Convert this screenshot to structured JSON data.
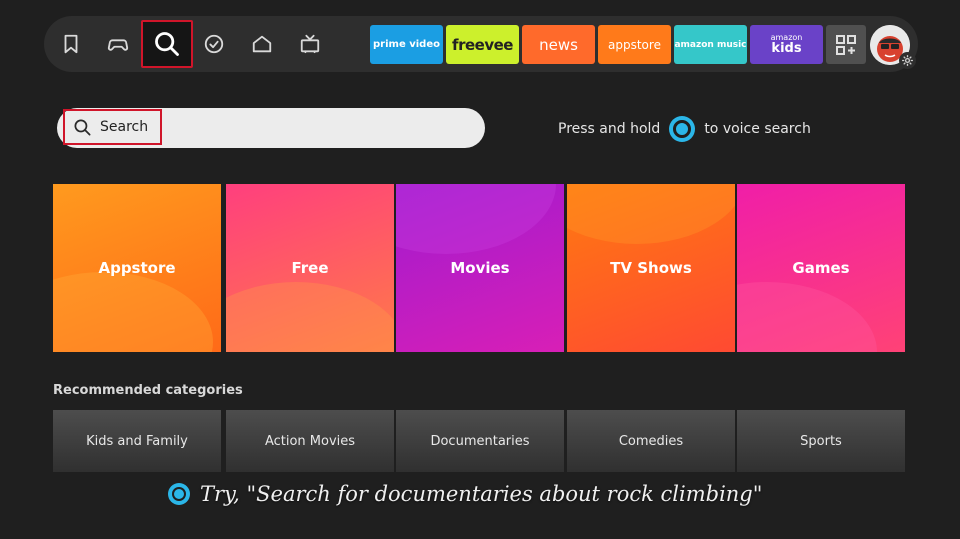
{
  "nav": {
    "icons": [
      {
        "name": "bookmark-icon",
        "label": ""
      },
      {
        "name": "game-controller-icon",
        "label": ""
      },
      {
        "name": "search-icon",
        "label": ""
      },
      {
        "name": "check-circle-icon",
        "label": ""
      },
      {
        "name": "home-icon",
        "label": ""
      },
      {
        "name": "live-tv-icon",
        "label": ""
      }
    ],
    "active_icon": "search-icon",
    "apps": [
      {
        "label": "prime video",
        "bg": "#1b9ee3",
        "fg": "#ffffff"
      },
      {
        "label": "freevee",
        "bg": "#ccf02c",
        "fg": "#222222"
      },
      {
        "label": "news",
        "bg": "#ff6a2b",
        "fg": "#ffffff"
      },
      {
        "label": "appstore",
        "bg": "#ff7a1a",
        "fg": "#ffffff"
      },
      {
        "label": "amazon music",
        "bg": "#35c7c9",
        "fg": "#ffffff"
      },
      {
        "label_line1": "amazon",
        "label_line2": "kids",
        "bg": "#6a42c8",
        "fg": "#ffffff"
      }
    ],
    "apps_grid_icon": "apps-grid-icon",
    "profile_icon": "profile-avatar-icon",
    "settings_icon": "gear-icon"
  },
  "search": {
    "placeholder": "Search",
    "voice_hint_prefix": "Press and hold",
    "voice_hint_suffix": "to voice search"
  },
  "categories": [
    {
      "label": "Appstore",
      "bg": "#ff8a1e",
      "bg2": "#ff6a18"
    },
    {
      "label": "Free",
      "bg": "#ff4f78",
      "bg2": "#ff7848"
    },
    {
      "label": "Movies",
      "bg": "#b21dcf",
      "bg2": "#d61fb8"
    },
    {
      "label": "TV Shows",
      "bg": "#ff6a14",
      "bg2": "#ff4a32"
    },
    {
      "label": "Games",
      "bg": "#f5229e",
      "bg2": "#ff3e78"
    }
  ],
  "recommended": {
    "heading": "Recommended categories",
    "items": [
      "Kids and Family",
      "Action Movies",
      "Documentaries",
      "Comedies",
      "Sports"
    ]
  },
  "bottom_hint": "Try, \"Search for documentaries about rock climbing\"",
  "colors": {
    "accent_red": "#d0152a",
    "alexa_blue": "#2bb6e8",
    "background": "#1f1f1f"
  }
}
